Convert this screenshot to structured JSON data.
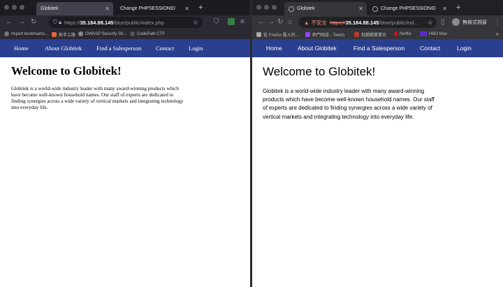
{
  "firefox": {
    "tabs": [
      {
        "label": "Globitek"
      },
      {
        "label": "Change PHPSESSIONID"
      }
    ],
    "url_bold": "35.184.88.145",
    "url_rest": "/blue/public/index.php",
    "url_prefix": "https://",
    "bookmarks": [
      "Import bookmarks...",
      "新手上路",
      "OWASP Security Sh...",
      "CodePath CTF"
    ]
  },
  "chrome": {
    "tabs": [
      {
        "label": "Globitek"
      },
      {
        "label": "Change PHPSESSIONID"
      }
    ],
    "insecure_label": "不安全",
    "url_prefix": "https://",
    "url_bold": "35.184.88.145",
    "url_rest": "/blue/public/ind...",
    "profile_label": "無痕式視窗",
    "bookmarks": [
      "從 Firefox 匯入的...",
      "熱門頻道 - Twitch",
      "批踢踢實業坊",
      "Netflix",
      "HBO Max"
    ]
  },
  "site": {
    "nav": [
      "Home",
      "About Globitek",
      "Find a Salesperson",
      "Contact",
      "Login"
    ],
    "heading": "Welcome to Globitek!",
    "paragraph": "Globitek is a world-wide industry leader with many award-winning products which have become well-known household names. Our staff of experts are dedicated to finding synergies across a wide variety of vertical markets and integrating technology into everyday life."
  },
  "colors": {
    "nav_bg": "#2a3f8f",
    "chrome_insecure": "#f28b82"
  }
}
